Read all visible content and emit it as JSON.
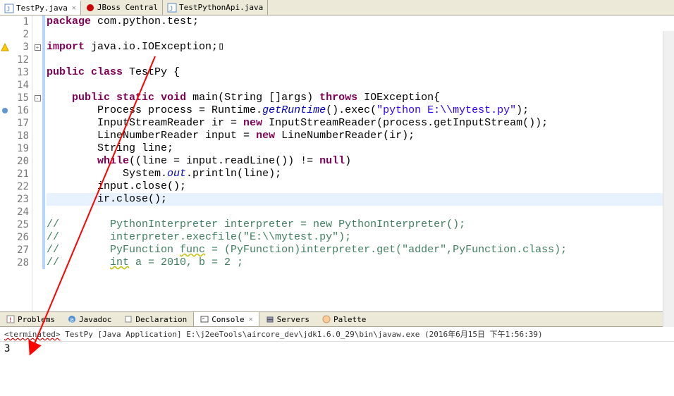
{
  "tabs": [
    {
      "label": "TestPy.java",
      "icon": "java-file-icon",
      "active": true,
      "closable": true
    },
    {
      "label": "JBoss Central",
      "icon": "jboss-icon",
      "active": false,
      "closable": false
    },
    {
      "label": "TestPythonApi.java",
      "icon": "java-file-icon",
      "active": false,
      "closable": false
    }
  ],
  "code": {
    "lines": [
      {
        "num": 1,
        "marker": "",
        "fold": "",
        "changed": true,
        "html": "<span class='kw'>package</span> com.python.test;"
      },
      {
        "num": 2,
        "marker": "",
        "fold": "",
        "changed": true,
        "html": ""
      },
      {
        "num": 3,
        "marker": "warn",
        "fold": "plus",
        "changed": true,
        "html": "<span class='kw'>import</span> java.io.IOException;▯"
      },
      {
        "num": 12,
        "marker": "",
        "fold": "",
        "changed": true,
        "html": ""
      },
      {
        "num": 13,
        "marker": "",
        "fold": "",
        "changed": true,
        "html": "<span class='kw'>public</span> <span class='kw'>class</span> TestPy {"
      },
      {
        "num": 14,
        "marker": "",
        "fold": "",
        "changed": true,
        "html": ""
      },
      {
        "num": 15,
        "marker": "",
        "fold": "minus",
        "changed": true,
        "html": "    <span class='kw'>public</span> <span class='kw'>static</span> <span class='kw'>void</span> main(String []args) <span class='kw'>throws</span> IOException{"
      },
      {
        "num": 16,
        "marker": "dot",
        "fold": "",
        "changed": true,
        "html": "        Process process = Runtime.<span class='staticfield'>getRuntime</span>().exec(<span class='str'>\"python E:\\\\mytest.py\"</span>);"
      },
      {
        "num": 17,
        "marker": "",
        "fold": "",
        "changed": true,
        "html": "        InputStreamReader ir = <span class='kw'>new</span> InputStreamReader(process.getInputStream());"
      },
      {
        "num": 18,
        "marker": "",
        "fold": "",
        "changed": true,
        "html": "        LineNumberReader input = <span class='kw'>new</span> LineNumberReader(ir);"
      },
      {
        "num": 19,
        "marker": "",
        "fold": "",
        "changed": true,
        "html": "        String line;"
      },
      {
        "num": 20,
        "marker": "",
        "fold": "",
        "changed": true,
        "html": "        <span class='kw'>while</span>((line = input.readLine()) != <span class='kw'>null</span>)"
      },
      {
        "num": 21,
        "marker": "",
        "fold": "",
        "changed": true,
        "html": "            System.<span class='staticfield'>out</span>.println(line);"
      },
      {
        "num": 22,
        "marker": "",
        "fold": "",
        "changed": true,
        "html": "        input.close();"
      },
      {
        "num": 23,
        "marker": "",
        "fold": "",
        "changed": true,
        "hl": true,
        "html": "        ir.close();"
      },
      {
        "num": 24,
        "marker": "",
        "fold": "",
        "changed": true,
        "html": ""
      },
      {
        "num": 25,
        "marker": "",
        "fold": "",
        "changed": true,
        "html": "<span class='com'>//        PythonInterpreter interpreter = new PythonInterpreter();</span>"
      },
      {
        "num": 26,
        "marker": "",
        "fold": "",
        "changed": true,
        "html": "<span class='com'>//        interpreter.execfile(\"E:\\\\mytest.py\");</span>"
      },
      {
        "num": 27,
        "marker": "",
        "fold": "",
        "changed": true,
        "html": "<span class='com'>//        PyFunction <span class='underline'>func</span> = (PyFunction)interpreter.get(\"adder\",PyFunction.class);</span>"
      },
      {
        "num": 28,
        "marker": "",
        "fold": "",
        "changed": true,
        "html": "<span class='com'>//        <span class='underline'>int</span> a = 2010, b = 2 ;</span>"
      }
    ]
  },
  "bottom_tabs": [
    {
      "label": "Problems",
      "icon": "problems-icon",
      "active": false
    },
    {
      "label": "Javadoc",
      "icon": "javadoc-icon",
      "active": false
    },
    {
      "label": "Declaration",
      "icon": "declaration-icon",
      "active": false
    },
    {
      "label": "Console",
      "icon": "console-icon",
      "active": true,
      "closable": true
    },
    {
      "label": "Servers",
      "icon": "servers-icon",
      "active": false
    },
    {
      "label": "Palette",
      "icon": "palette-icon",
      "active": false
    }
  ],
  "console": {
    "status_prefix": "<terminated>",
    "status_text": " TestPy [Java Application] E:\\j2eeTools\\aircore_dev\\jdk1.6.0_29\\bin\\javaw.exe (2016年6月15日 下午1:56:39)",
    "output": "3"
  }
}
